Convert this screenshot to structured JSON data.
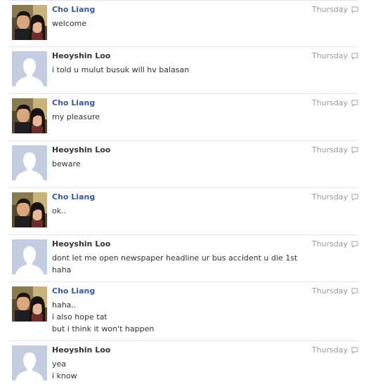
{
  "thread": {
    "messages": [
      {
        "author": "Cho Liang",
        "kind": "friend",
        "avatar": "couple-photo",
        "time": "Thursday",
        "lines": [
          "welcome"
        ]
      },
      {
        "author": "Heoyshin Loo",
        "kind": "self",
        "avatar": "default-silhouette",
        "time": "Thursday",
        "lines": [
          "i told u mulut busuk will hv balasan"
        ]
      },
      {
        "author": "Cho Liang",
        "kind": "friend",
        "avatar": "couple-photo",
        "time": "Thursday",
        "lines": [
          "my pleasure"
        ]
      },
      {
        "author": "Heoyshin Loo",
        "kind": "self",
        "avatar": "default-silhouette",
        "time": "Thursday",
        "lines": [
          "beware"
        ]
      },
      {
        "author": "Cho Liang",
        "kind": "friend",
        "avatar": "couple-photo",
        "time": "Thursday",
        "lines": [
          "ok.."
        ]
      },
      {
        "author": "Heoyshin Loo",
        "kind": "self",
        "avatar": "default-silhouette",
        "time": "Thursday",
        "lines": [
          "dont let me open newspaper headline ur bus accident u die 1st",
          "haha"
        ]
      },
      {
        "author": "Cho Liang",
        "kind": "friend",
        "avatar": "couple-photo",
        "time": "Thursday",
        "lines": [
          "haha..",
          "i also hope tat",
          "but i think it won't happen"
        ]
      },
      {
        "author": "Heoyshin Loo",
        "kind": "self",
        "avatar": "default-silhouette",
        "time": "Thursday",
        "lines": [
          "yea",
          "i know"
        ]
      }
    ]
  },
  "colors": {
    "friend_name": "#3b5998",
    "self_name": "#333333",
    "timestamp": "#999999",
    "divider": "#e2e6ee",
    "silhouette_bg": "#c3cce0"
  },
  "icons": {
    "reply": "reply-speech-bubble-icon"
  }
}
